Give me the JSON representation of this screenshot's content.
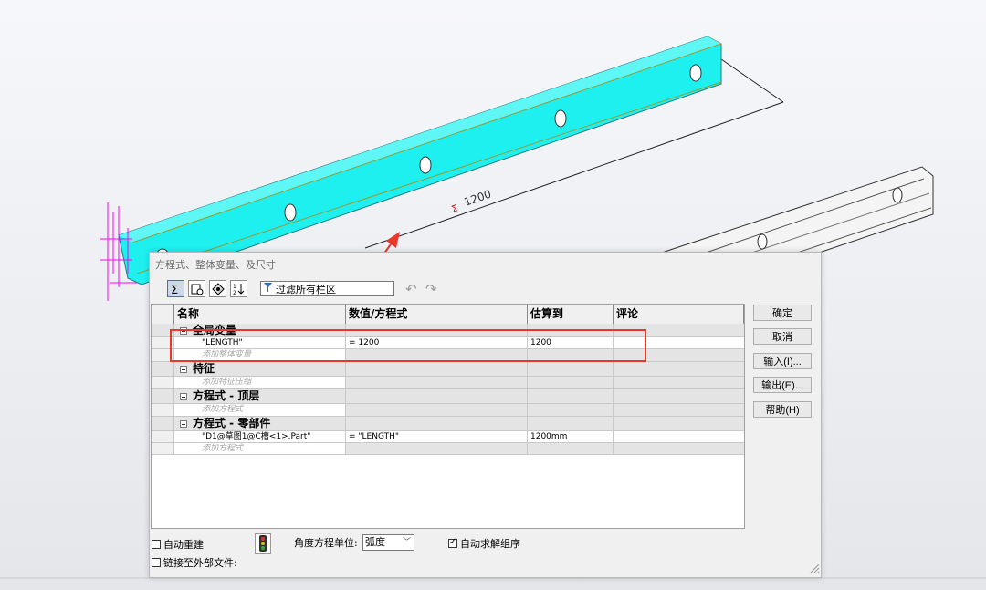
{
  "dialog": {
    "title": "方程式、整体变量、及尺寸",
    "filter_label": "过滤所有栏区"
  },
  "toolbar_icons": [
    "equation-view-icon",
    "sketch-equation-view-icon",
    "dimension-view-icon",
    "ordered-view-icon"
  ],
  "grid": {
    "headers": [
      "名称",
      "数值/方程式",
      "估算到",
      "评论"
    ],
    "groups": [
      {
        "label": "全局变量",
        "rows": [
          {
            "name": "\"LENGTH\"",
            "value": "= 1200",
            "eval": "1200",
            "comment": ""
          },
          {
            "name": "添加整体变量",
            "value": "",
            "eval": "",
            "comment": "",
            "placeholder": true
          }
        ]
      },
      {
        "label": "特征",
        "rows": [
          {
            "name": "添加特征压缩",
            "value": "",
            "eval": "",
            "comment": "",
            "placeholder": true
          }
        ]
      },
      {
        "label": "方程式 - 顶层",
        "rows": [
          {
            "name": "添加方程式",
            "value": "",
            "eval": "",
            "comment": "",
            "placeholder": true
          }
        ]
      },
      {
        "label": "方程式 - 零部件",
        "rows": [
          {
            "name": "\"D1@草图1@C槽<1>.Part\"",
            "value": "= \"LENGTH\"",
            "eval": "1200mm",
            "comment": ""
          },
          {
            "name": "添加方程式",
            "value": "",
            "eval": "",
            "comment": "",
            "placeholder": true
          }
        ]
      }
    ]
  },
  "buttons": {
    "ok": "确定",
    "cancel": "取消",
    "import": "输入(I)...",
    "export": "输出(E)...",
    "help": "帮助(H)"
  },
  "options": {
    "auto_rebuild": "自动重建",
    "auto_rebuild_checked": false,
    "link_external": "链接至外部文件:",
    "link_external_checked": false,
    "angle_unit_label": "角度方程单位:",
    "angle_unit_value": "弧度",
    "auto_solve": "自动求解组序",
    "auto_solve_checked": true
  },
  "model": {
    "dimension_text": "1200",
    "dimension_prefix": "Σ"
  },
  "colors": {
    "part_fill": "#1ef0f0",
    "highlight": "#e8372c",
    "dim_color": "#ff00ff"
  }
}
